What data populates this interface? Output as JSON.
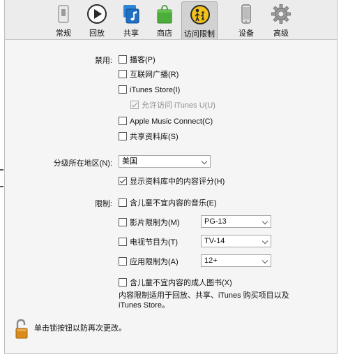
{
  "toolbar": {
    "items": [
      {
        "label": "常规",
        "icon": "general-switch-icon"
      },
      {
        "label": "回放",
        "icon": "play-icon"
      },
      {
        "label": "共享",
        "icon": "music-note-icon"
      },
      {
        "label": "商店",
        "icon": "store-bag-icon"
      },
      {
        "label": "访问限制",
        "icon": "parental-restrictions-icon",
        "active": true
      },
      {
        "label": "设备",
        "icon": "device-icon"
      },
      {
        "label": "高级",
        "icon": "gear-icon"
      }
    ]
  },
  "disable": {
    "label": "禁用:",
    "options": [
      {
        "label": "播客(P)",
        "checked": false
      },
      {
        "label": "互联网广播(R)",
        "checked": false
      },
      {
        "label": "iTunes Store(I)",
        "checked": false
      },
      {
        "label": "允许访问 iTunes U(U)",
        "checked": true,
        "disabled": true
      },
      {
        "label": "Apple Music Connect(C)",
        "checked": false
      },
      {
        "label": "共享资料库(S)",
        "checked": false
      }
    ]
  },
  "region": {
    "label": "分级所在地区(N):",
    "value": "美国"
  },
  "show_ratings": {
    "label": "显示资料库中的内容评分(H)",
    "checked": true
  },
  "restrict": {
    "label": "限制:",
    "explicit_music": {
      "label": "含儿童不宜内容的音乐(E)",
      "checked": false
    },
    "movies": {
      "label": "影片限制为(M)",
      "value": "PG-13",
      "checked": false
    },
    "tv": {
      "label": "电视节目为(T)",
      "value": "TV-14",
      "checked": false
    },
    "apps": {
      "label": "应用限制为(A)",
      "value": "12+",
      "checked": false
    },
    "books": {
      "label": "含儿童不宜内容的成人图书(X)",
      "checked": false
    }
  },
  "note": {
    "line1": "内容限制适用于回放、共享、iTunes 购买项目以及",
    "line2": "iTunes Store。"
  },
  "lock": {
    "text": "单击锁按钮以防再次更改。"
  },
  "colors": {
    "lock_body": "#d98b1f",
    "active_tab": "#d2d2d2",
    "store_green": "#4cae3a",
    "music_blue": "#1f7fd6"
  }
}
